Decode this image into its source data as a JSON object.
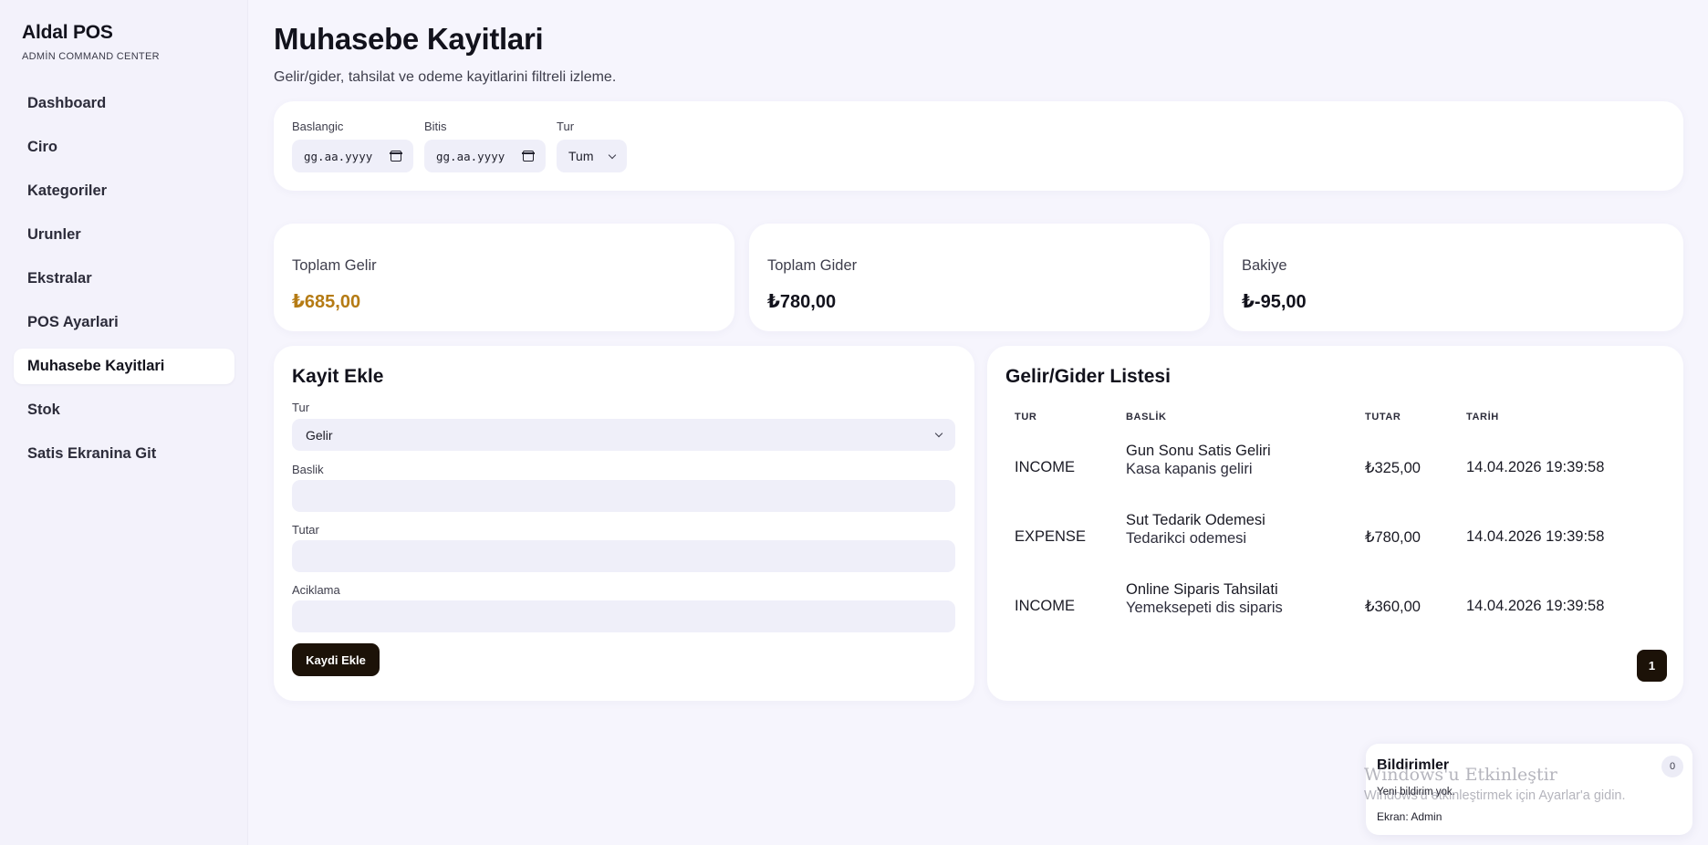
{
  "brand": {
    "title": "Aldal POS",
    "subtitle": "ADMİN COMMAND CENTER"
  },
  "sidebar": {
    "items": [
      {
        "label": "Dashboard"
      },
      {
        "label": "Ciro"
      },
      {
        "label": "Kategoriler"
      },
      {
        "label": "Urunler"
      },
      {
        "label": "Ekstralar"
      },
      {
        "label": "POS Ayarlari"
      },
      {
        "label": "Muhasebe Kayitlari",
        "active": true
      },
      {
        "label": "Stok"
      },
      {
        "label": "Satis Ekranina Git"
      }
    ]
  },
  "page": {
    "title": "Muhasebe Kayitlari",
    "subtitle": "Gelir/gider, tahsilat ve odeme kayitlarini filtreli izleme."
  },
  "filters": {
    "start": {
      "label": "Baslangic",
      "value": "gg.aa.yyyy"
    },
    "end": {
      "label": "Bitis",
      "value": "gg.aa.yyyy"
    },
    "type": {
      "label": "Tur",
      "value": "Tum"
    }
  },
  "stats": {
    "income": {
      "label": "Toplam Gelir",
      "value": "₺685,00",
      "color": "#b57b14"
    },
    "expense": {
      "label": "Toplam Gider",
      "value": "₺780,00"
    },
    "balance": {
      "label": "Bakiye",
      "value": "₺-95,00"
    }
  },
  "form": {
    "title": "Kayit Ekle",
    "type": {
      "label": "Tur",
      "value": "Gelir"
    },
    "title_field": {
      "label": "Baslik",
      "value": ""
    },
    "amount": {
      "label": "Tutar",
      "value": ""
    },
    "description": {
      "label": "Aciklama",
      "value": ""
    },
    "submit_label": "Kaydi Ekle"
  },
  "list": {
    "title": "Gelir/Gider Listesi",
    "columns": [
      "TUR",
      "BASLİK",
      "TUTAR",
      "TARİH"
    ],
    "rows": [
      {
        "type": "INCOME",
        "title": "Gun Sonu Satis Geliri",
        "desc": "Kasa kapanis geliri",
        "amount": "₺325,00",
        "date": "14.04.2026 19:39:58"
      },
      {
        "type": "EXPENSE",
        "title": "Sut Tedarik Odemesi",
        "desc": "Tedarikci odemesi",
        "amount": "₺780,00",
        "date": "14.04.2026 19:39:58"
      },
      {
        "type": "INCOME",
        "title": "Online Siparis Tahsilati",
        "desc": "Yemeksepeti dis siparis",
        "amount": "₺360,00",
        "date": "14.04.2026 19:39:58"
      }
    ],
    "page": "1"
  },
  "notifications": {
    "title": "Bildirimler",
    "count": "0",
    "empty": "Yeni bildirim yok.",
    "screen": "Ekran: Admin"
  },
  "watermark": {
    "title": "Windows'u Etkinleştir",
    "subtitle": "Windows'u etkinleştirmek için Ayarlar'a gidin."
  },
  "colors": {
    "accent_dark": "#1c1208",
    "background": "#f6f5fd",
    "income_gold": "#b57b14"
  }
}
